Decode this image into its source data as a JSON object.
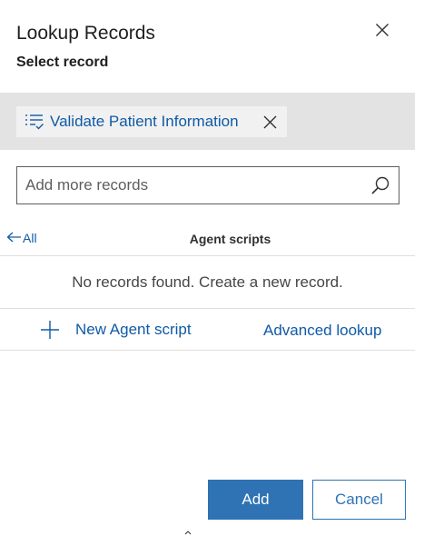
{
  "dialog": {
    "title": "Lookup Records",
    "subtitle": "Select record"
  },
  "selected_records": [
    {
      "label": "Validate Patient Information",
      "icon": "list-check-icon"
    }
  ],
  "search": {
    "value": "",
    "placeholder": "Add more records",
    "icon": "search-icon"
  },
  "results": {
    "back_label": "All",
    "entity_title": "Agent scripts",
    "empty_message": "No records found. Create a new record."
  },
  "actions": {
    "new_record_label": "New Agent script",
    "advanced_lookup_label": "Advanced lookup"
  },
  "footer": {
    "add_label": "Add",
    "cancel_label": "Cancel"
  },
  "colors": {
    "accent": "#2f73b5",
    "link": "#0f5aa6",
    "selected_band": "#e3e3e3",
    "chip": "#f1f1f1"
  }
}
